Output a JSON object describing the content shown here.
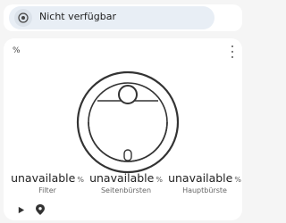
{
  "status": {
    "text": "Nicht verfügbar",
    "icon": "robot-vacuum-icon"
  },
  "card": {
    "percent_label": "%",
    "menu_icon": "more-vert-icon",
    "image": "robot-vacuum-illustration"
  },
  "stats": [
    {
      "value": "unavailable",
      "unit": "%",
      "label": "Filter"
    },
    {
      "value": "unavailable",
      "unit": "%",
      "label": "Seitenbürsten"
    },
    {
      "value": "unavailable",
      "unit": "%",
      "label": "Hauptbürste"
    }
  ],
  "controls": {
    "play_icon": "play-icon",
    "locate_icon": "map-marker-icon"
  }
}
